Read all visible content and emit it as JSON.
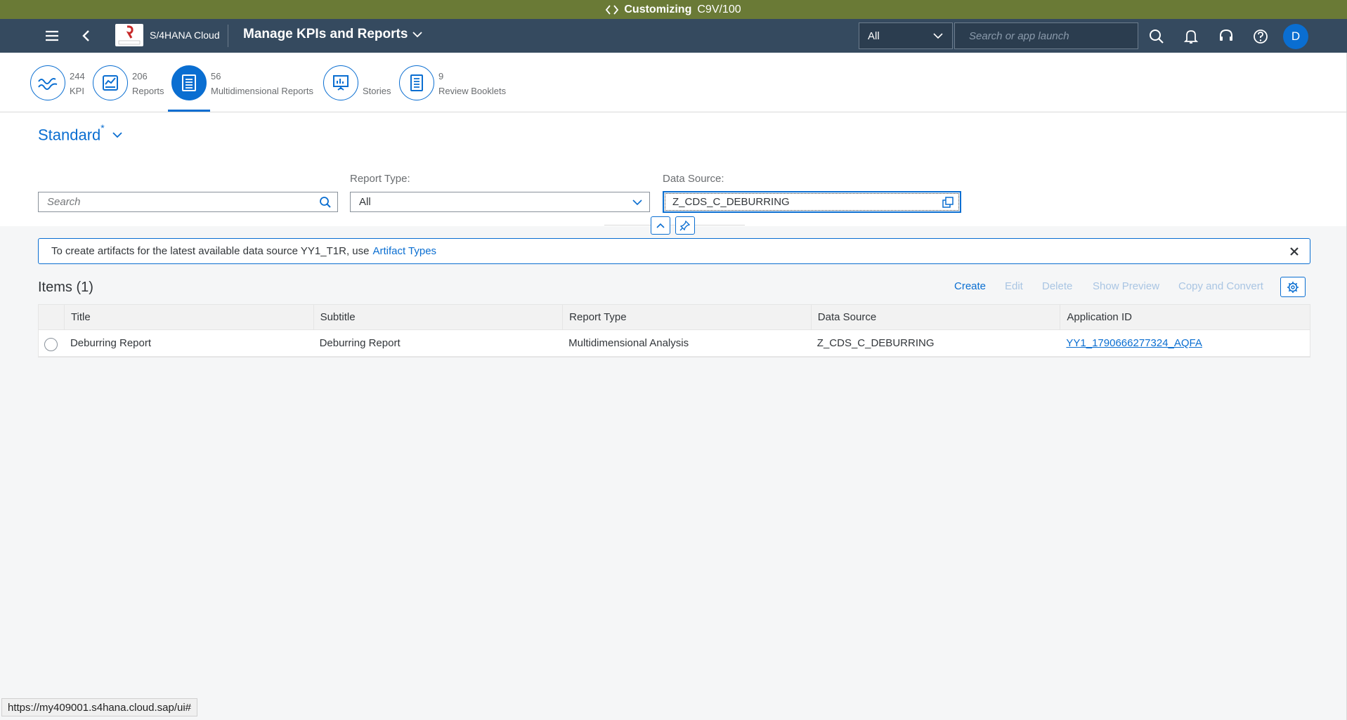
{
  "customizing_bar": {
    "title": "Customizing",
    "code": "C9V/100"
  },
  "shell": {
    "brand": "S/4HANA Cloud",
    "logo_text": "RELIABLE",
    "app_title": "Manage KPIs and Reports",
    "scope": "All",
    "search_placeholder": "Search or app launch",
    "avatar_initial": "D"
  },
  "tabs": [
    {
      "count": "244",
      "label": "KPI",
      "icon": "kpi-icon",
      "active": false
    },
    {
      "count": "206",
      "label": "Reports",
      "icon": "reports-icon",
      "active": false
    },
    {
      "count": "56",
      "label": "Multidimensional Reports",
      "icon": "document-list-icon",
      "active": true
    },
    {
      "count": "",
      "label": "Stories",
      "icon": "presentation-icon",
      "active": false
    },
    {
      "count": "9",
      "label": "Review Booklets",
      "icon": "booklet-icon",
      "active": false
    }
  ],
  "filters": {
    "variant": "Standard",
    "variant_modified": "*",
    "search_placeholder": "Search",
    "report_type_label": "Report Type:",
    "report_type_value": "All",
    "data_source_label": "Data Source:",
    "data_source_value": "Z_CDS_C_DEBURRING"
  },
  "message": {
    "text": "To create artifacts for the latest available data source YY1_T1R, use",
    "link": "Artifact Types"
  },
  "table": {
    "title": "Items (1)",
    "actions": {
      "create": "Create",
      "edit": "Edit",
      "delete": "Delete",
      "preview": "Show Preview",
      "copy": "Copy and Convert"
    },
    "columns": [
      "Title",
      "Subtitle",
      "Report Type",
      "Data Source",
      "Application ID"
    ],
    "rows": [
      {
        "title": "Deburring Report",
        "subtitle": "Deburring Report",
        "report_type": "Multidimensional Analysis",
        "data_source": "Z_CDS_C_DEBURRING",
        "app_id": "YY1_1790666277324_AQFA"
      }
    ]
  },
  "status_url": "https://my409001.s4hana.cloud.sap/ui#",
  "colors": {
    "shell": "#354a5f",
    "accent": "#0a6ed1",
    "customizing": "#6a7a36"
  }
}
